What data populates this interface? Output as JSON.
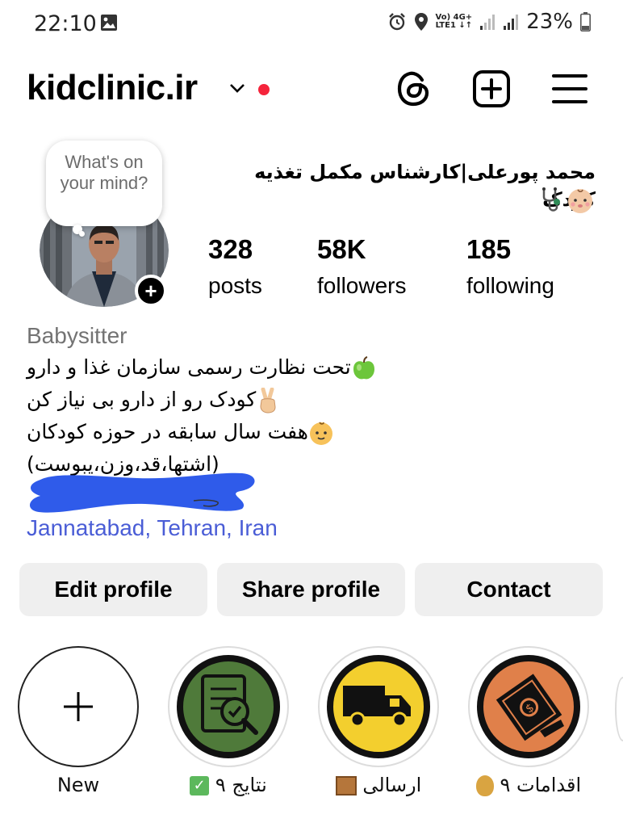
{
  "status_bar": {
    "time": "22:10",
    "net_top": "Vo) 4G+",
    "net_bottom": "LTE1 ↓↑",
    "battery": "23%"
  },
  "header": {
    "username": "kidclinic.ir",
    "notification_color": "#f5243b"
  },
  "avatar": {
    "note_prompt": "What's on your mind?"
  },
  "profile": {
    "full_name": "محمد پورعلی|کارشناس مکمل تغذیه کودک",
    "stats": [
      {
        "value": "328",
        "label": "posts"
      },
      {
        "value": "58K",
        "label": "followers"
      },
      {
        "value": "185",
        "label": "following"
      }
    ],
    "category": "Babysitter",
    "bio": [
      "تحت نظارت رسمی سازمان غذا و دارو",
      "کودک رو از دارو بی نیاز کن",
      "هفت سال سابقه در حوزه کودکان",
      "(اشتها،قد،وزن،یبوست)"
    ],
    "location": "Jannatabad, Tehran, Iran"
  },
  "actions": {
    "edit": "Edit profile",
    "share": "Share profile",
    "contact": "Contact"
  },
  "highlights": [
    {
      "label": "New"
    },
    {
      "label": "نتایج ٩",
      "icon": "document-check-icon",
      "color": "#4f7a3a"
    },
    {
      "label": "ارسالی",
      "icon": "truck-icon",
      "color": "#f3cf2e"
    },
    {
      "label": "اقدامات ٩",
      "icon": "money-icon",
      "color": "#e0804a"
    }
  ]
}
